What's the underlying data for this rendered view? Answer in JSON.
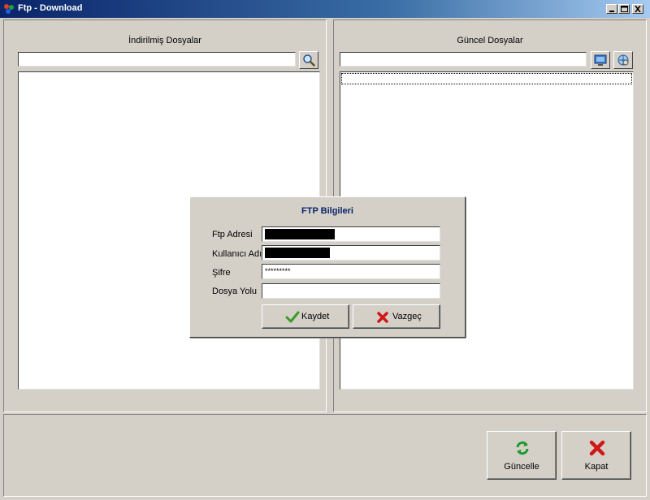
{
  "window": {
    "title": "Ftp - Download"
  },
  "left_pane": {
    "label": "İndirilmiş Dosyalar",
    "search_value": ""
  },
  "right_pane": {
    "label": "Güncel Dosyalar",
    "path_value": ""
  },
  "dialog": {
    "title": "FTP Bilgileri",
    "fields": {
      "ftp_address_label": "Ftp Adresi",
      "username_label": "Kullanıcı Adı",
      "password_label": "Şifre",
      "password_value": "*********",
      "path_label": "Dosya Yolu",
      "path_value": ""
    },
    "save_label": "Kaydet",
    "cancel_label": "Vazgeç"
  },
  "bottom": {
    "update_label": "Güncelle",
    "close_label": "Kapat"
  },
  "colors": {
    "title_bar": "#0a246a",
    "dialog_title": "#0a246a",
    "face": "#d4d0c8"
  }
}
